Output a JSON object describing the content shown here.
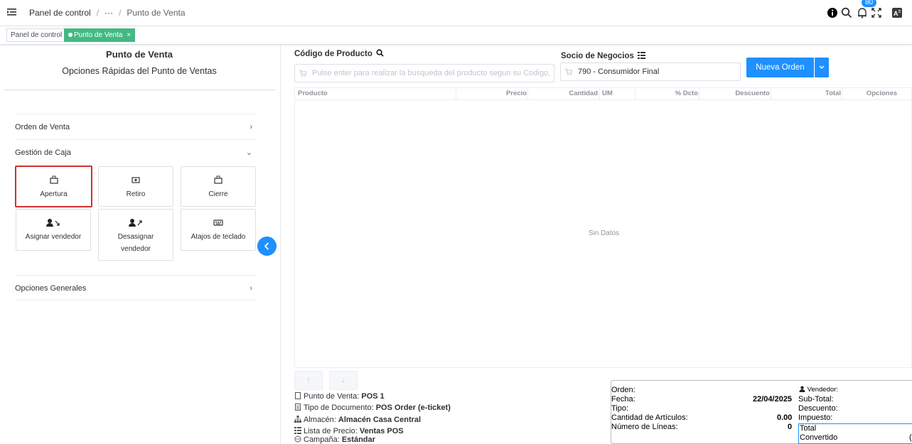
{
  "header": {
    "breadcrumb": [
      "Panel de control",
      "···",
      "Punto de Venta"
    ],
    "notification_count": "80",
    "icons": [
      "menu-icon",
      "info-icon",
      "search-icon",
      "bell-icon",
      "fullscreen-icon",
      "language-icon"
    ]
  },
  "tags": {
    "items": [
      {
        "label": "Panel de control",
        "active": false
      },
      {
        "label": "Punto de Venta",
        "close": "×",
        "active": true
      }
    ]
  },
  "left_panel": {
    "title": "Punto de Venta",
    "subtitle": "Opciones Rápidas del Punto de Ventas",
    "sections": {
      "orden_venta": "Orden de Venta",
      "gestion_caja": "Gestión de Caja",
      "opciones_generales": "Opciones Generales"
    },
    "cash_buttons": [
      {
        "label": "Apertura",
        "icon": "cash-register-icon"
      },
      {
        "label": "Retiro",
        "icon": "money-icon"
      },
      {
        "label": "Cierre",
        "icon": "cash-register-icon"
      },
      {
        "label": "Asignar vendedor",
        "icon": "user-assign-icon"
      },
      {
        "label": "Desasignar vendedor",
        "icon": "user-unassign-icon"
      },
      {
        "label": "Atajos de teclado",
        "icon": "keyboard-icon"
      }
    ]
  },
  "product": {
    "label": "Código de Producto",
    "placeholder": "Pulse enter para realizar la busqueda del producto segun su Codigo, N"
  },
  "partner": {
    "label": "Socio de Negocios",
    "value": "790 - Consumidor Final"
  },
  "new_order_label": "Nueva Orden",
  "table": {
    "columns": [
      "Producto",
      "Precio",
      "Cantidad",
      "UM",
      "% Dcto",
      "Descuento",
      "Total",
      "Opciones"
    ],
    "empty_text": "Sin Datos"
  },
  "order_info": {
    "pos_label": "Punto de Venta:",
    "pos_value": "POS 1",
    "doc_label": "Tipo de Documento:",
    "doc_value": "POS Order (e-ticket)",
    "warehouse_label": "Almacén:",
    "warehouse_value": "Almacén Casa Central",
    "pricelist_label": "Lista de Precio:",
    "pricelist_value": "Ventas POS",
    "campaign_label": "Campaña:",
    "campaign_value": "Estándar"
  },
  "summary": {
    "orden_label": "Orden:",
    "fecha_label": "Fecha:",
    "fecha_value": "22/04/2025",
    "tipo_label": "Tipo:",
    "cantidad_label": "Cantidad de Artículos:",
    "cantidad_value": "0.00",
    "lineas_label": "Número de Líneas:",
    "lineas_value": "0",
    "vendedor_label": "Vendedor:",
    "subtotal_label": "Sub-Total:",
    "descuento_label": "Descuento:",
    "impuesto_label": "Impuesto:",
    "total_label": "Total",
    "convertido_label": "Convertido",
    "convertido_value": "("
  },
  "colors": {
    "primary": "#1e90ff",
    "tag_active": "#42b983",
    "highlight": "#d32f2f"
  }
}
